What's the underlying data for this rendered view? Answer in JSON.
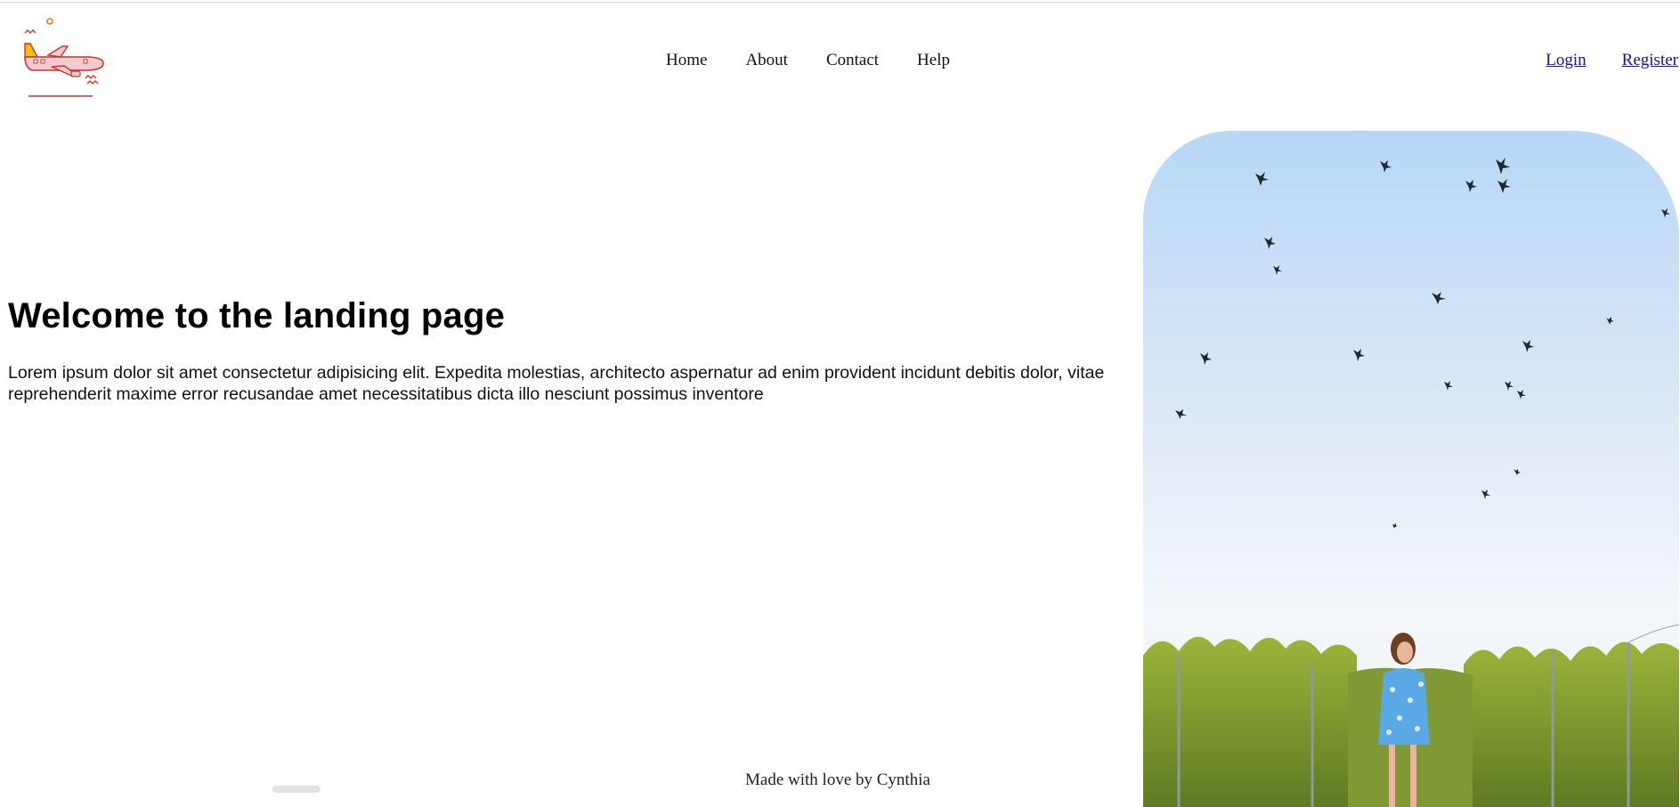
{
  "header": {
    "logo_icon": "airplane-icon",
    "nav": [
      {
        "label": "Home"
      },
      {
        "label": "About"
      },
      {
        "label": "Contact"
      },
      {
        "label": "Help"
      }
    ],
    "auth": {
      "login_label": "Login",
      "register_label": "Register"
    }
  },
  "hero": {
    "title": "Welcome to the landing page",
    "body": "Lorem ipsum dolor sit amet consectetur adipisicing elit. Expedita molestias, architecto aspernatur ad enim provident incidunt debitis dolor, vitae reprehenderit maxime error recusandae amet necessitatibus dicta illo nesciunt possimus inventore"
  },
  "footer": {
    "text": "Made with love by Cynthia"
  },
  "colors": {
    "link": "#1a0dab",
    "logo_accent": "#c0392b",
    "logo_wing": "#f2c200"
  }
}
